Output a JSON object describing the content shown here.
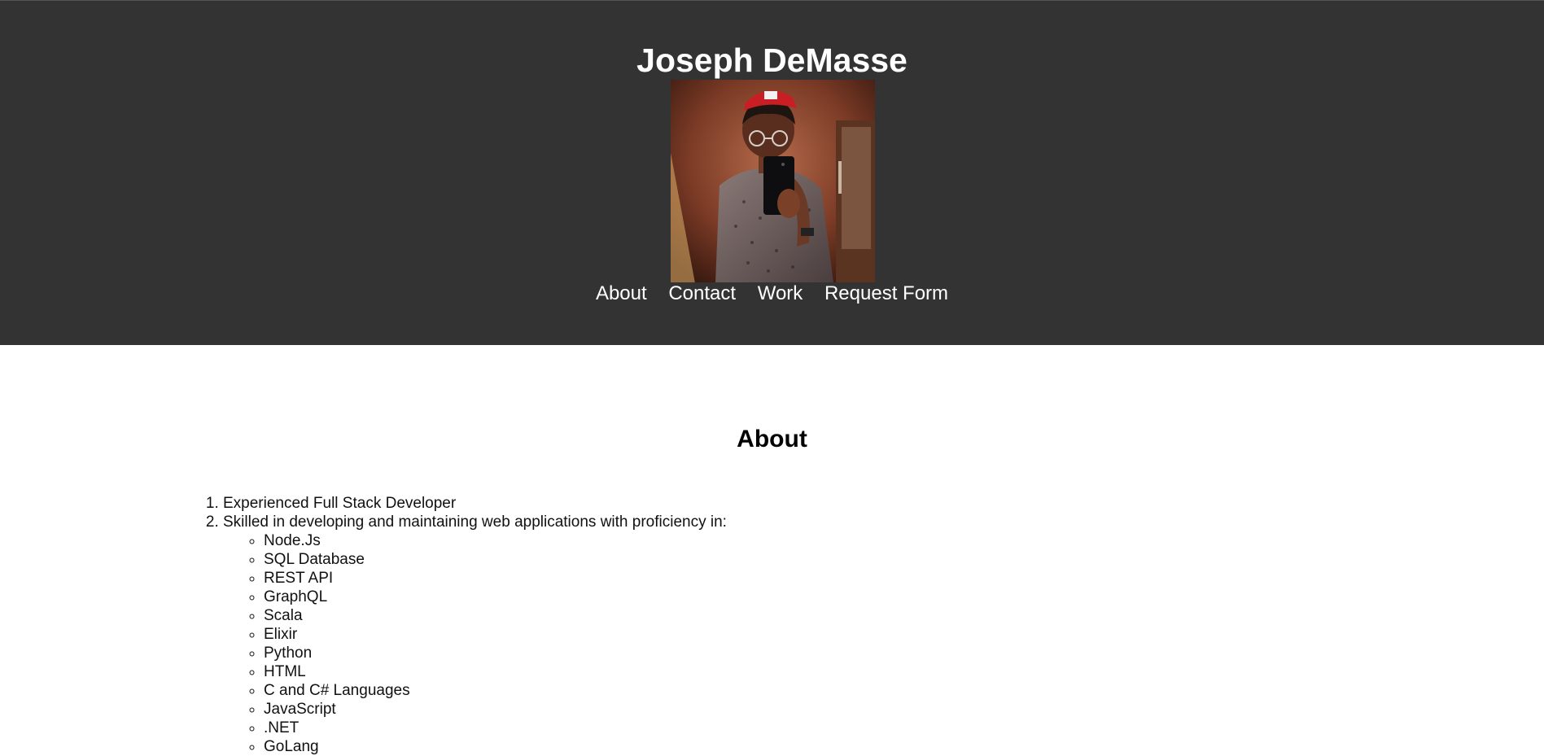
{
  "header": {
    "title": "Joseph DeMasse",
    "background": "#333333"
  },
  "nav": {
    "items": [
      {
        "label": "About"
      },
      {
        "label": "Contact"
      },
      {
        "label": "Work"
      },
      {
        "label": "Request Form"
      }
    ]
  },
  "about": {
    "heading": "About",
    "items": [
      "Experienced Full Stack Developer",
      "Skilled in developing and maintaining web applications with proficiency in:"
    ],
    "skills": [
      "Node.Js",
      "SQL Database",
      "REST API",
      "GraphQL",
      "Scala",
      "Elixir",
      "Python",
      "HTML",
      "C and C# Languages",
      "JavaScript",
      ".NET",
      "GoLang"
    ]
  }
}
